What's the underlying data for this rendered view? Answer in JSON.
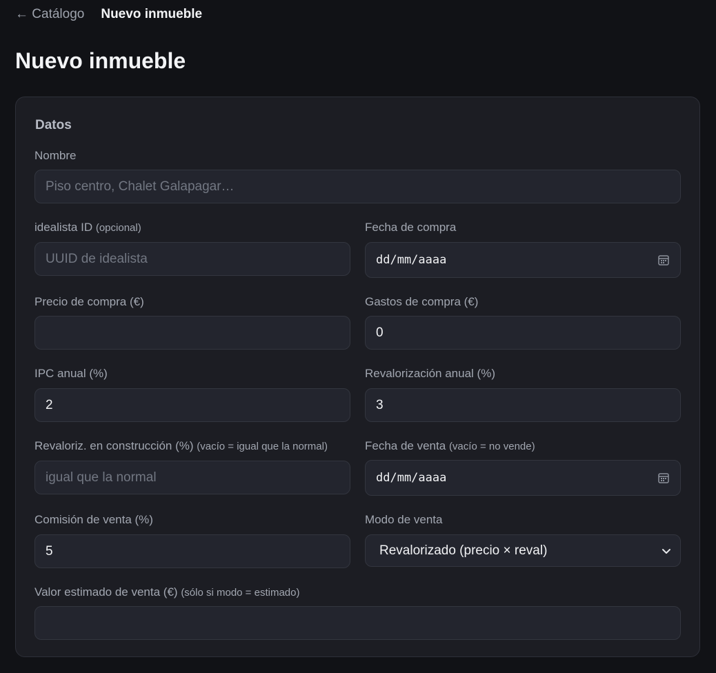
{
  "nav": {
    "back": "← Catálogo",
    "current": "Nuevo inmueble"
  },
  "title": "Nuevo inmueble",
  "section": "Datos",
  "fields": {
    "nombre": {
      "label": "Nombre",
      "placeholder": "Piso centro, Chalet Galapagar…"
    },
    "idealista": {
      "label": "idealista ID",
      "hint": "(opcional)",
      "placeholder": "UUID de idealista"
    },
    "fecha_compra": {
      "label": "Fecha de compra",
      "value": "dd/mm/aaaa"
    },
    "precio_compra": {
      "label": "Precio de compra (€)",
      "value": ""
    },
    "gastos_compra": {
      "label": "Gastos de compra (€)",
      "value": "0"
    },
    "ipc": {
      "label": "IPC anual (%)",
      "value": "2"
    },
    "revalorizacion": {
      "label": "Revalorización anual (%)",
      "value": "3"
    },
    "reval_construccion": {
      "label": "Revaloriz. en construcción (%)",
      "hint": "(vacío = igual que la normal)",
      "placeholder": "igual que la normal"
    },
    "fecha_venta": {
      "label": "Fecha de venta",
      "hint": "(vacío = no vende)",
      "value": "dd/mm/aaaa"
    },
    "comision": {
      "label": "Comisión de venta (%)",
      "value": "5"
    },
    "modo_venta": {
      "label": "Modo de venta",
      "value": "Revalorizado (precio × reval)"
    },
    "valor_estimado": {
      "label": "Valor estimado de venta (€)",
      "hint": "(sólo si modo = estimado)",
      "value": ""
    }
  },
  "icons": {
    "calendar": "calendar-icon",
    "chevron": "chevron-down-icon"
  },
  "colors": {
    "background": "#111216",
    "card": "#1c1d23",
    "input": "#23252e"
  }
}
